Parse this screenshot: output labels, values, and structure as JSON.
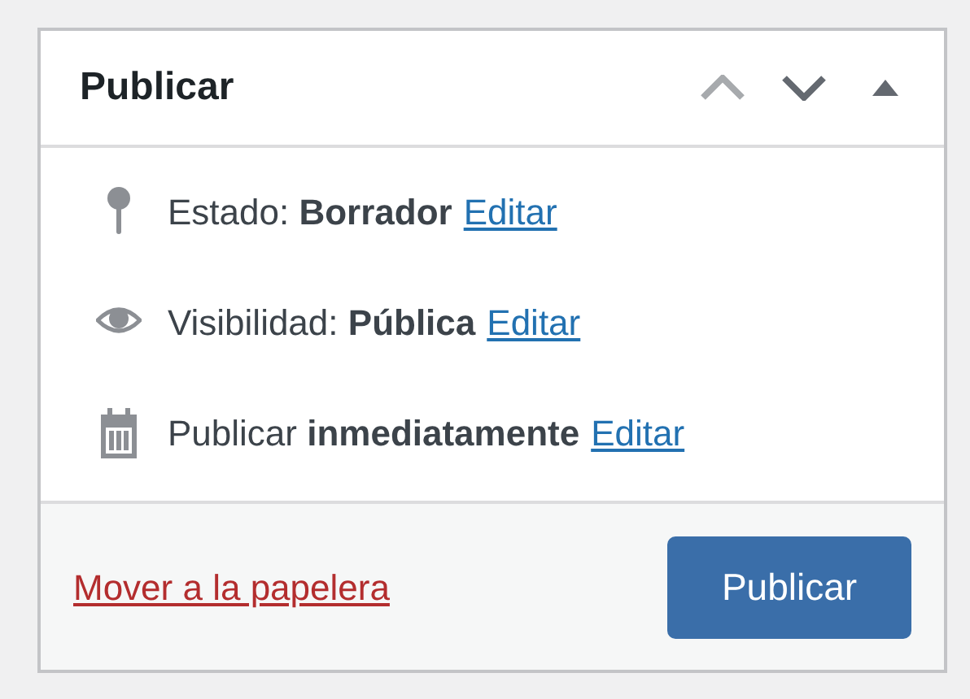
{
  "panel": {
    "title": "Publicar",
    "controls": [
      {
        "kind": "up",
        "disabled": true
      },
      {
        "kind": "down",
        "disabled": false
      },
      {
        "kind": "toggle",
        "disabled": false
      }
    ]
  },
  "rows": [
    {
      "kind": "status",
      "text": "Estado: **Borrador**",
      "link": "Editar"
    },
    {
      "kind": "visibility",
      "text": "Visibilidad: **Pública**",
      "link": "Editar"
    },
    {
      "kind": "schedule",
      "text": "Publicar **inmediatamente**",
      "link": "Editar"
    }
  ],
  "footer": {
    "trash_link": "Mover a la papelera",
    "button": "Publicar"
  }
}
